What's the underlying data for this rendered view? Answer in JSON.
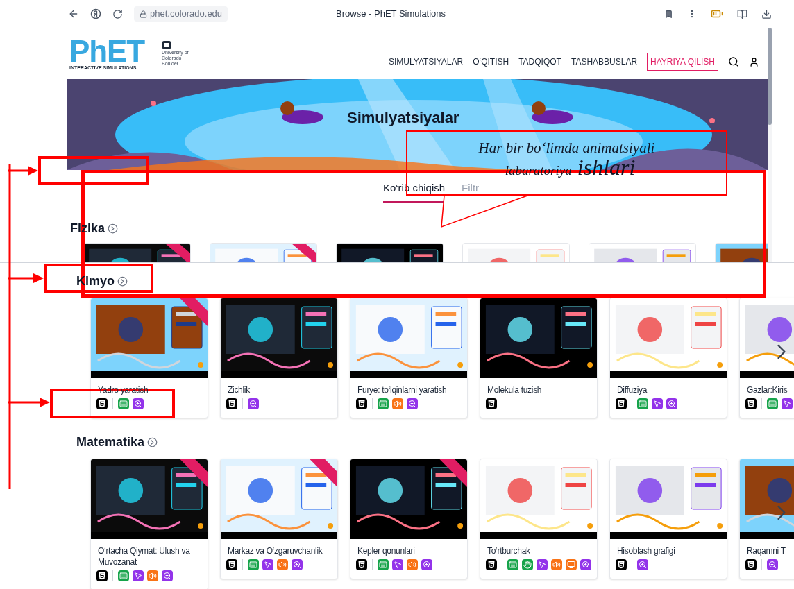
{
  "browser": {
    "url": "phet.colorado.edu",
    "title": "Browse - PhET Simulations"
  },
  "header": {
    "logo": "PhET",
    "logo_tagline": "INTERACTIVE SIMULATIONS",
    "university": "University of Colorado Boulder",
    "nav": [
      "SIMULYATSIYALAR",
      "O‘QITISH",
      "TADQIQOT",
      "TASHABBUSLAR"
    ],
    "donate": "HAYRIYA QILISH"
  },
  "hero": {
    "title": "Simulyatsiyalar"
  },
  "tabs": [
    {
      "label": "Ko‘rib chiqish",
      "selected": true
    },
    {
      "label": "Filtr",
      "selected": false
    }
  ],
  "sections": [
    {
      "title": "Fizika",
      "cut": true,
      "cards": [
        {
          "new": true
        },
        {
          "new": true
        },
        {
          "new": false
        },
        {
          "new": false
        },
        {
          "new": false
        },
        {
          "new": false
        }
      ]
    },
    {
      "title": "Kimyo",
      "cut": false,
      "cards": [
        {
          "title": "Yadro yaratish",
          "new": true,
          "features": [
            {
              "kind": "html5"
            },
            {
              "kind": "keyboard"
            },
            {
              "kind": "zoom"
            }
          ]
        },
        {
          "title": "Zichlik",
          "new": false,
          "features": [
            {
              "kind": "html5"
            },
            {
              "kind": "zoom"
            }
          ]
        },
        {
          "title": "Furye: to‘lqinlarni yaratish",
          "new": false,
          "features": [
            {
              "kind": "html5"
            },
            {
              "kind": "keyboard"
            },
            {
              "kind": "sound"
            },
            {
              "kind": "zoom"
            }
          ]
        },
        {
          "title": "Molekula tuzish",
          "new": false,
          "features": [
            {
              "kind": "html5"
            }
          ]
        },
        {
          "title": "Diffuziya",
          "new": false,
          "features": [
            {
              "kind": "html5"
            },
            {
              "kind": "keyboard"
            },
            {
              "kind": "pointer"
            },
            {
              "kind": "zoom"
            }
          ]
        },
        {
          "title": "Gazlar:Kiris",
          "new": false,
          "features": [
            {
              "kind": "html5"
            },
            {
              "kind": "keyboard"
            },
            {
              "kind": "pointer"
            }
          ]
        }
      ]
    },
    {
      "title": "Matematika",
      "cut": false,
      "cards": [
        {
          "title": "O‘rtacha Qiymat: Ulush va Muvozanat",
          "new": true,
          "features": [
            {
              "kind": "html5"
            },
            {
              "kind": "keyboard"
            },
            {
              "kind": "pointer"
            },
            {
              "kind": "sound"
            },
            {
              "kind": "zoom"
            }
          ]
        },
        {
          "title": "Markaz va O‘zgaruvchanlik",
          "new": true,
          "features": [
            {
              "kind": "html5"
            },
            {
              "kind": "keyboard"
            },
            {
              "kind": "pointer"
            },
            {
              "kind": "sound"
            },
            {
              "kind": "zoom"
            }
          ]
        },
        {
          "title": "Kepler qonunlari",
          "new": true,
          "features": [
            {
              "kind": "html5"
            },
            {
              "kind": "keyboard"
            },
            {
              "kind": "pointer"
            },
            {
              "kind": "sound"
            },
            {
              "kind": "zoom"
            }
          ]
        },
        {
          "title": "To‘rtburchak",
          "new": false,
          "features": [
            {
              "kind": "html5"
            },
            {
              "kind": "keyboard"
            },
            {
              "kind": "touch"
            },
            {
              "kind": "pointer"
            },
            {
              "kind": "sound"
            },
            {
              "kind": "screen"
            },
            {
              "kind": "zoom"
            }
          ]
        },
        {
          "title": "Hisoblash grafigi",
          "new": false,
          "features": [
            {
              "kind": "html5"
            },
            {
              "kind": "zoom"
            }
          ]
        },
        {
          "title": "Raqamni T",
          "new": false,
          "features": [
            {
              "kind": "html5"
            },
            {
              "kind": "zoom"
            }
          ]
        }
      ]
    }
  ],
  "callout": {
    "lines": [
      "Har bir bo‘limda animatsiyali",
      "labaratoriya"
    ],
    "emphasis": "ishlari"
  }
}
